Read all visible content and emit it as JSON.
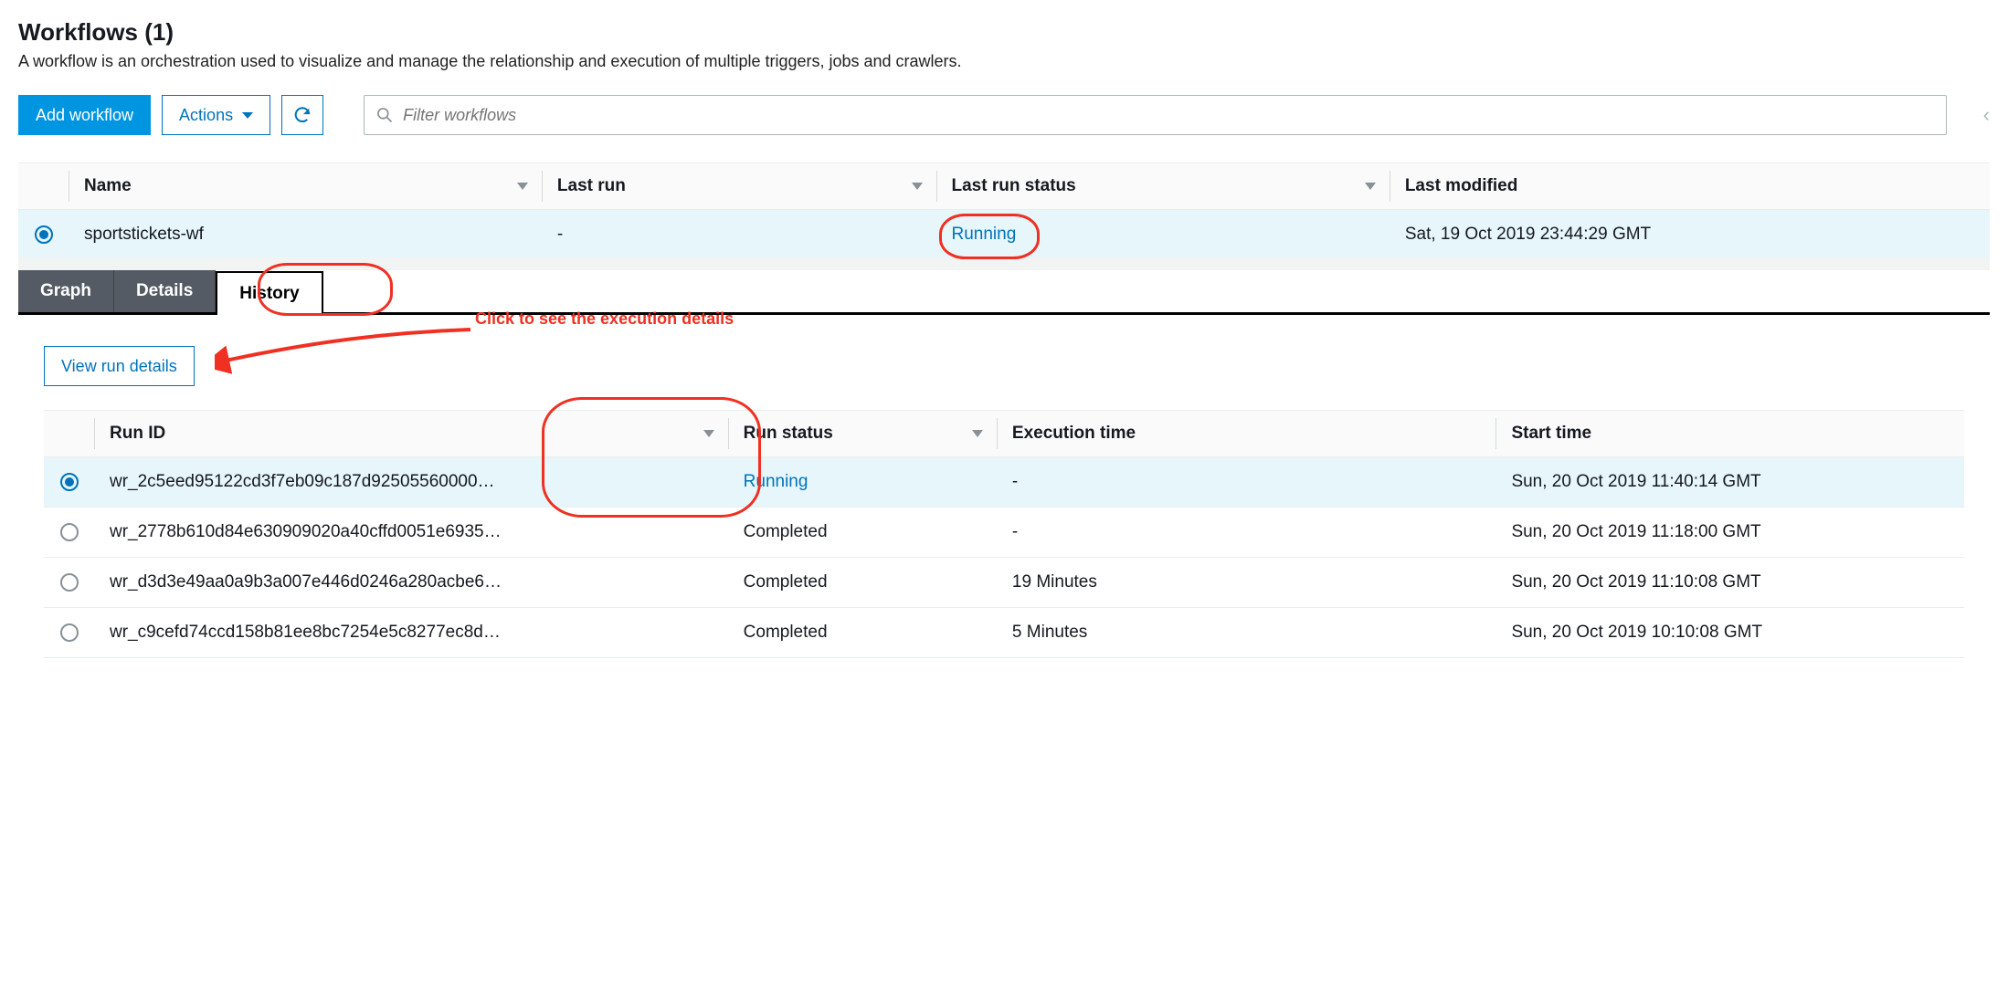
{
  "header": {
    "title": "Workflows (1)",
    "subtitle": "A workflow is an orchestration used to visualize and manage the relationship and execution of multiple triggers, jobs and crawlers."
  },
  "toolbar": {
    "add_label": "Add workflow",
    "actions_label": "Actions",
    "search_placeholder": "Filter workflows"
  },
  "workflows_table": {
    "columns": {
      "name": "Name",
      "last_run": "Last run",
      "last_run_status": "Last run status",
      "last_modified": "Last modified"
    },
    "row": {
      "name": "sportstickets-wf",
      "last_run": "-",
      "last_run_status": "Running",
      "last_modified": "Sat, 19 Oct 2019 23:44:29 GMT",
      "selected": true
    }
  },
  "tabs": {
    "graph": "Graph",
    "details": "Details",
    "history": "History",
    "active": "history"
  },
  "annotation": {
    "text": "Click to see the execution details"
  },
  "history": {
    "view_run_label": "View run details",
    "columns": {
      "run_id": "Run ID",
      "run_status": "Run status",
      "execution_time": "Execution time",
      "start_time": "Start time"
    },
    "rows": [
      {
        "selected": true,
        "run_id": "wr_2c5eed95122cd3f7eb09c187d92505560000…",
        "run_status": "Running",
        "execution_time": "-",
        "start_time": "Sun, 20 Oct 2019 11:40:14 GMT"
      },
      {
        "selected": false,
        "run_id": "wr_2778b610d84e630909020a40cffd0051e6935…",
        "run_status": "Completed",
        "execution_time": "-",
        "start_time": "Sun, 20 Oct 2019 11:18:00 GMT"
      },
      {
        "selected": false,
        "run_id": "wr_d3d3e49aa0a9b3a007e446d0246a280acbe6…",
        "run_status": "Completed",
        "execution_time": "19 Minutes",
        "start_time": "Sun, 20 Oct 2019 11:10:08 GMT"
      },
      {
        "selected": false,
        "run_id": "wr_c9cefd74ccd158b81ee8bc7254e5c8277ec8d…",
        "run_status": "Completed",
        "execution_time": "5 Minutes",
        "start_time": "Sun, 20 Oct 2019 10:10:08 GMT"
      }
    ]
  }
}
